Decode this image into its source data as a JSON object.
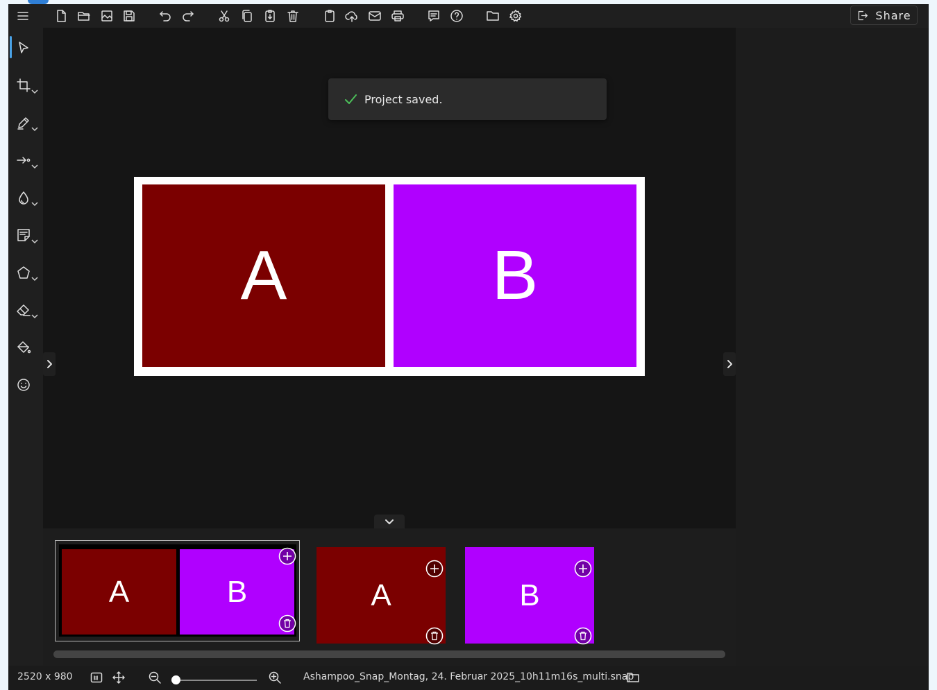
{
  "toolbar": {
    "buttons": [
      {
        "icon": "menu-icon"
      },
      {
        "icon": "new-file-icon"
      },
      {
        "icon": "open-folder-icon"
      },
      {
        "icon": "open-image-icon"
      },
      {
        "icon": "save-icon"
      },
      {
        "icon": "undo-icon"
      },
      {
        "icon": "redo-icon"
      },
      {
        "icon": "cut-icon"
      },
      {
        "icon": "copy-icon"
      },
      {
        "icon": "paste-icon"
      },
      {
        "icon": "delete-icon"
      },
      {
        "icon": "clipboard-icon"
      },
      {
        "icon": "cloud-upload-icon"
      },
      {
        "icon": "email-icon"
      },
      {
        "icon": "print-icon"
      },
      {
        "icon": "feedback-icon"
      },
      {
        "icon": "help-icon"
      },
      {
        "icon": "folder-icon"
      },
      {
        "icon": "settings-icon"
      }
    ],
    "share_label": "Share"
  },
  "tools": [
    {
      "icon": "select-arrow-icon",
      "active": true
    },
    {
      "icon": "crop-icon"
    },
    {
      "icon": "pen-icon"
    },
    {
      "icon": "arrow-tool-icon"
    },
    {
      "icon": "blur-drop-icon"
    },
    {
      "icon": "note-icon"
    },
    {
      "icon": "shape-icon"
    },
    {
      "icon": "eraser-icon"
    },
    {
      "icon": "fill-bucket-icon"
    },
    {
      "icon": "emoji-icon"
    }
  ],
  "toast": {
    "message": "Project saved.",
    "icon": "check-icon",
    "color": "#4cc05a"
  },
  "montage": {
    "panels": [
      {
        "label": "A",
        "color": "#7b0000"
      },
      {
        "label": "B",
        "color": "#b000ff"
      }
    ]
  },
  "filmstrip": {
    "items": [
      {
        "type": "montage",
        "labels": [
          "A",
          "B"
        ],
        "selected": true
      },
      {
        "type": "single",
        "label": "A",
        "color": "#7b0000"
      },
      {
        "type": "single",
        "label": "B",
        "color": "#b000ff"
      }
    ]
  },
  "statusbar": {
    "dimensions": "2520 x 980",
    "filename": "Ashampoo_Snap_Montag, 24. Februar 2025_10h11m16s_multi.snap",
    "zoom_fraction": 0.0
  }
}
